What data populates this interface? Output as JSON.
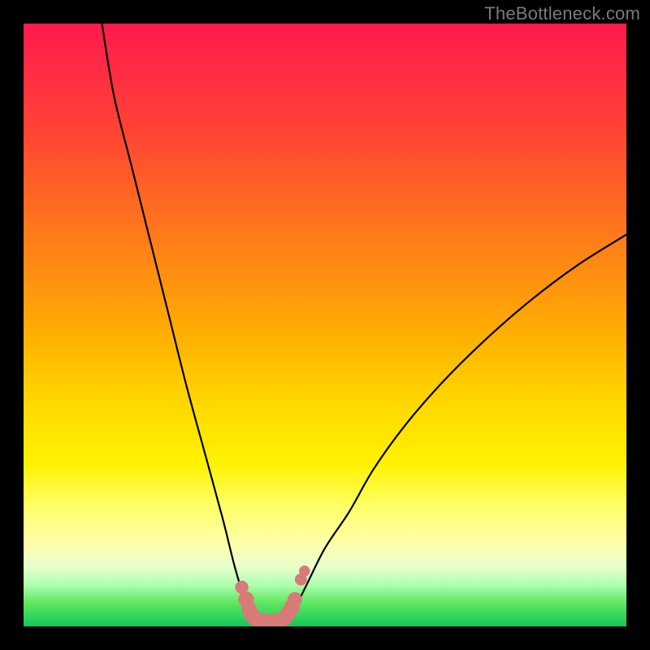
{
  "watermark": "TheBottleneck.com",
  "chart_data": {
    "type": "line",
    "title": "",
    "xlabel": "",
    "ylabel": "",
    "xlim": [
      0,
      100
    ],
    "ylim": [
      0,
      100
    ],
    "series": [
      {
        "name": "left-branch",
        "x": [
          13,
          15,
          18,
          21,
          24,
          27,
          30,
          33,
          35,
          36.5,
          37.5,
          38
        ],
        "values": [
          100,
          88,
          76,
          64,
          52,
          40,
          29,
          18,
          10,
          5,
          2,
          1
        ]
      },
      {
        "name": "right-branch",
        "x": [
          44,
          45,
          47,
          50,
          54,
          58,
          63,
          69,
          76,
          84,
          92,
          100
        ],
        "values": [
          1,
          3,
          7,
          13,
          19,
          26,
          33,
          40,
          47,
          54,
          60,
          65
        ]
      }
    ],
    "markers": {
      "name": "highlight-dots",
      "color": "#d77a78",
      "points": [
        {
          "x": 36.2,
          "y": 6.5,
          "r": 1.1
        },
        {
          "x": 36.9,
          "y": 4.5,
          "r": 1.3
        },
        {
          "x": 37.4,
          "y": 2.9,
          "r": 1.3
        },
        {
          "x": 37.9,
          "y": 1.8,
          "r": 1.3
        },
        {
          "x": 38.6,
          "y": 1.2,
          "r": 1.3
        },
        {
          "x": 39.5,
          "y": 0.9,
          "r": 1.3
        },
        {
          "x": 40.5,
          "y": 0.8,
          "r": 1.3
        },
        {
          "x": 41.5,
          "y": 0.8,
          "r": 1.3
        },
        {
          "x": 42.5,
          "y": 0.9,
          "r": 1.3
        },
        {
          "x": 43.3,
          "y": 1.4,
          "r": 1.3
        },
        {
          "x": 43.9,
          "y": 2.2,
          "r": 1.3
        },
        {
          "x": 44.5,
          "y": 3.2,
          "r": 1.3
        },
        {
          "x": 45.0,
          "y": 4.5,
          "r": 1.2
        },
        {
          "x": 46.0,
          "y": 7.8,
          "r": 1.0
        },
        {
          "x": 46.6,
          "y": 9.2,
          "r": 0.9
        }
      ]
    }
  }
}
